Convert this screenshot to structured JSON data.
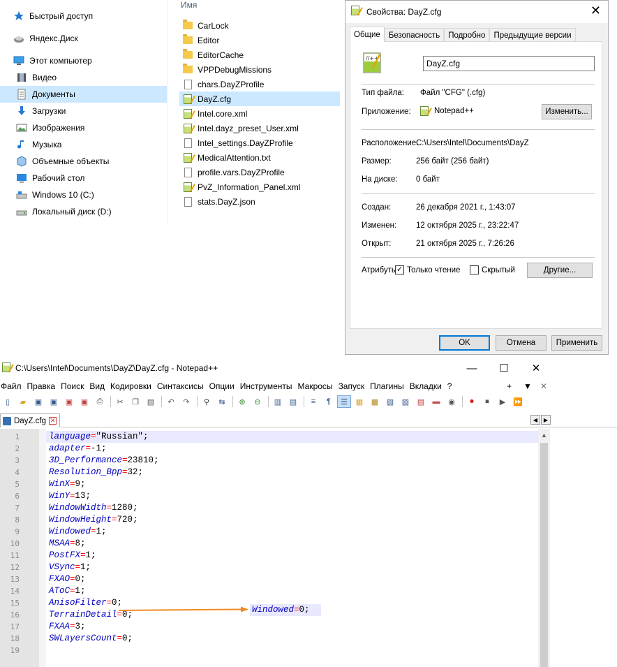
{
  "explorer": {
    "nav": [
      {
        "label": "Быстрый доступ",
        "icon": "star-icon"
      },
      {
        "label": "Яндекс.Диск",
        "icon": "yandex-disk-icon"
      },
      {
        "label": "Этот компьютер",
        "icon": "computer-icon"
      },
      {
        "label": "Видео",
        "icon": "video-icon"
      },
      {
        "label": "Документы",
        "icon": "documents-icon"
      },
      {
        "label": "Загрузки",
        "icon": "downloads-icon"
      },
      {
        "label": "Изображения",
        "icon": "pictures-icon"
      },
      {
        "label": "Музыка",
        "icon": "music-icon"
      },
      {
        "label": "Объемные объекты",
        "icon": "3d-objects-icon"
      },
      {
        "label": "Рабочий стол",
        "icon": "desktop-icon"
      },
      {
        "label": "Windows 10 (C:)",
        "icon": "drive-c-icon"
      },
      {
        "label": "Локальный диск (D:)",
        "icon": "drive-d-icon"
      }
    ],
    "column_header": "Имя",
    "files": [
      {
        "name": "CarLock",
        "icon": "folder-icon"
      },
      {
        "name": "Editor",
        "icon": "folder-icon"
      },
      {
        "name": "EditorCache",
        "icon": "folder-icon"
      },
      {
        "name": "VPPDebugMissions",
        "icon": "folder-icon"
      },
      {
        "name": "chars.DayZProfile",
        "icon": "file-icon"
      },
      {
        "name": "DayZ.cfg",
        "icon": "notepadpp-file-icon"
      },
      {
        "name": "Intel.core.xml",
        "icon": "notepadpp-file-icon"
      },
      {
        "name": "Intel.dayz_preset_User.xml",
        "icon": "notepadpp-file-icon"
      },
      {
        "name": "Intel_settings.DayZProfile",
        "icon": "file-icon"
      },
      {
        "name": "MedicalAttention.txt",
        "icon": "notepadpp-file-icon"
      },
      {
        "name": "profile.vars.DayZProfile",
        "icon": "file-icon"
      },
      {
        "name": "PvZ_Information_Panel.xml",
        "icon": "notepadpp-file-icon"
      },
      {
        "name": "stats.DayZ.json",
        "icon": "json-file-icon"
      }
    ]
  },
  "properties": {
    "title": "Свойства: DayZ.cfg",
    "close": "✕",
    "tabs": [
      "Общие",
      "Безопасность",
      "Подробно",
      "Предыдущие версии"
    ],
    "file_name": "DayZ.cfg",
    "file_type_label": "Тип файла:",
    "file_type_value": "Файл \"CFG\" (.cfg)",
    "app_label": "Приложение:",
    "app_value": "Notepad++",
    "change_button": "Изменить...",
    "location_label": "Расположение:",
    "location_value": "C:\\Users\\Intel\\Documents\\DayZ",
    "size_label": "Размер:",
    "size_value": "256 байт (256 байт)",
    "disk_label": "На диске:",
    "disk_value": "0 байт",
    "created_label": "Создан:",
    "created_value": "26 декабря 2021 г., 1:43:07",
    "modified_label": "Изменен:",
    "modified_value": "12 октября 2025 г., 23:22:47",
    "opened_label": "Открыт:",
    "opened_value": "21 октября 2025 г., 7:26:26",
    "attributes_label": "Атрибуты:",
    "readonly_label": "Только чтение",
    "readonly_checked": true,
    "hidden_label": "Скрытый",
    "hidden_checked": false,
    "other_button": "Другие...",
    "ok_button": "OK",
    "cancel_button": "Отмена",
    "apply_button": "Применить"
  },
  "npp": {
    "title": "C:\\Users\\Intel\\Documents\\DayZ\\DayZ.cfg - Notepad++",
    "window_controls": {
      "minimize": "—",
      "maximize": "☐",
      "close": "✕"
    },
    "menu": [
      "Файл",
      "Правка",
      "Поиск",
      "Вид",
      "Кодировки",
      "Синтаксисы",
      "Опции",
      "Инструменты",
      "Макросы",
      "Запуск",
      "Плагины",
      "Вкладки",
      "?"
    ],
    "menu_right": {
      "plus": "+",
      "dropdown": "▼",
      "close": "✕"
    },
    "tab_label": "DayZ.cfg",
    "tab_close": "✕",
    "lines": [
      {
        "n": "1",
        "key": "language",
        "eq": "=",
        "val": "\"Russian\";"
      },
      {
        "n": "2",
        "key": "adapter",
        "eq": "=",
        "val": "-1;"
      },
      {
        "n": "3",
        "key": "3D_Performance",
        "eq": "=",
        "val": "23810;"
      },
      {
        "n": "4",
        "key": "Resolution_Bpp",
        "eq": "=",
        "val": "32;"
      },
      {
        "n": "5",
        "key": "WinX",
        "eq": "=",
        "val": "9;"
      },
      {
        "n": "6",
        "key": "WinY",
        "eq": "=",
        "val": "13;"
      },
      {
        "n": "7",
        "key": "WindowWidth",
        "eq": "=",
        "val": "1280;"
      },
      {
        "n": "8",
        "key": "WindowHeight",
        "eq": "=",
        "val": "720;"
      },
      {
        "n": "9",
        "key": "Windowed",
        "eq": "=",
        "val": "1;"
      },
      {
        "n": "10",
        "key": "MSAA",
        "eq": "=",
        "val": "8;"
      },
      {
        "n": "11",
        "key": "PostFX",
        "eq": "=",
        "val": "1;"
      },
      {
        "n": "12",
        "key": "VSync",
        "eq": "=",
        "val": "1;"
      },
      {
        "n": "13",
        "key": "FXAO",
        "eq": "=",
        "val": "0;"
      },
      {
        "n": "14",
        "key": "AToC",
        "eq": "=",
        "val": "1;"
      },
      {
        "n": "15",
        "key": "AnisoFilter",
        "eq": "=",
        "val": "0;"
      },
      {
        "n": "16",
        "key": "TerrainDetail",
        "eq": "=",
        "val": "0;"
      },
      {
        "n": "17",
        "key": "FXAA",
        "eq": "=",
        "val": "3;"
      },
      {
        "n": "18",
        "key": "SWLayersCount",
        "eq": "=",
        "val": "0;"
      },
      {
        "n": "19",
        "key": "",
        "eq": "",
        "val": ""
      }
    ],
    "annotation": {
      "key": "Windowed",
      "eq": "=",
      "val": "0;",
      "arrow_color": "#f08a24"
    }
  }
}
